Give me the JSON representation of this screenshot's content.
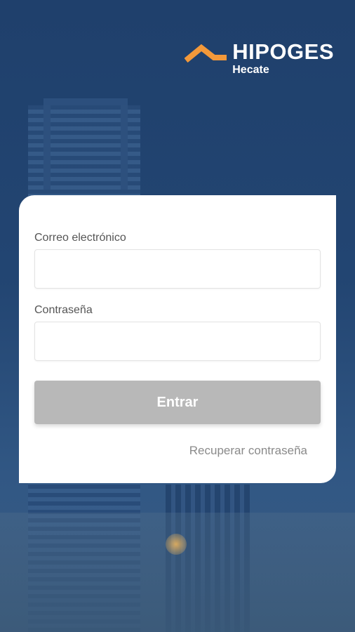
{
  "brand": {
    "name": "HIPOGES",
    "product": "Hecate",
    "accent_color": "#f3993a"
  },
  "form": {
    "email_label": "Correo electrónico",
    "email_value": "",
    "password_label": "Contraseña",
    "password_value": "",
    "submit_label": "Entrar",
    "submit_color": "#b8b8b8",
    "recover_label": "Recuperar contraseña"
  }
}
